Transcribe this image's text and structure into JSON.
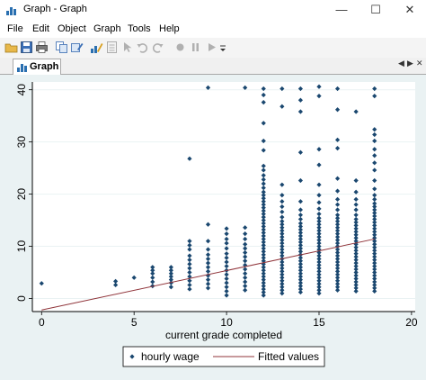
{
  "window": {
    "title": "Graph - Graph",
    "minimize_glyph": "—",
    "maximize_glyph": "☐",
    "close_glyph": "✕"
  },
  "menu": {
    "items": [
      "File",
      "Edit",
      "Object",
      "Graph",
      "Tools",
      "Help"
    ]
  },
  "toolbar": {
    "icons": [
      "open-folder-icon",
      "save-icon",
      "print-icon",
      "copy-icon",
      "rename-icon",
      "graph-editor-icon",
      "properties-icon",
      "pointer-icon",
      "undo-icon",
      "redo-icon",
      "record-icon",
      "pause-icon",
      "play-icon",
      "dropdown-icon"
    ]
  },
  "tab": {
    "label": "Graph",
    "nav_left": "◀",
    "nav_right": "▶",
    "close": "✕"
  },
  "colors": {
    "marker": "#1a476f",
    "fitted_line": "#90353b",
    "plot_background": "#ffffff",
    "graph_background": "#eaf2f3",
    "grid": "#eaf2f3"
  },
  "chart_data": {
    "type": "scatter",
    "xlabel": "current grade completed",
    "ylabel": "",
    "xlim": [
      -0.5,
      20.2
    ],
    "ylim": [
      -2.5,
      41.5
    ],
    "xticks": [
      0,
      5,
      10,
      15,
      20
    ],
    "yticks": [
      0,
      10,
      20,
      30,
      40
    ],
    "grid": true,
    "legend_position": "bottom",
    "series": [
      {
        "name": "hourly wage",
        "kind": "scatter",
        "columns": [
          {
            "x": 0,
            "ys": [
              2.9
            ]
          },
          {
            "x": 4,
            "ys": [
              2.6,
              3.3
            ]
          },
          {
            "x": 5,
            "ys": [
              4.0
            ]
          },
          {
            "x": 6,
            "ys": [
              2.4,
              3.2,
              4.0,
              4.8,
              5.4,
              6.0
            ]
          },
          {
            "x": 7,
            "ys": [
              2.2,
              3.0,
              3.6,
              4.2,
              4.8,
              5.4,
              6.0
            ]
          },
          {
            "x": 8,
            "ys": [
              1.8,
              2.6,
              3.4,
              4.2,
              5.0,
              5.8,
              6.6,
              7.4,
              8.2,
              9.4,
              10.2,
              11.0,
              26.8
            ]
          },
          {
            "x": 9,
            "ys": [
              2.0,
              2.8,
              3.6,
              4.4,
              5.2,
              6.0,
              6.8,
              7.6,
              8.4,
              9.4,
              11.0,
              14.2,
              40.4
            ]
          },
          {
            "x": 10,
            "ys": [
              0.6,
              1.4,
              2.2,
              3.0,
              3.8,
              4.6,
              5.4,
              6.2,
              7.0,
              7.8,
              8.6,
              9.6,
              10.6,
              11.4,
              12.4,
              13.4
            ]
          },
          {
            "x": 11,
            "ys": [
              1.6,
              2.4,
              3.2,
              4.0,
              4.8,
              5.6,
              6.4,
              7.2,
              8.0,
              8.8,
              9.6,
              10.4,
              11.4,
              12.4,
              13.6,
              40.4
            ]
          },
          {
            "x": 12,
            "ys": [
              0.6,
              1.2,
              1.8,
              2.4,
              3.0,
              3.6,
              4.2,
              4.8,
              5.4,
              6.0,
              6.6,
              7.2,
              7.8,
              8.4,
              9.0,
              9.6,
              10.2,
              10.8,
              11.4,
              12.0,
              12.6,
              13.2,
              13.8,
              14.4,
              15.0,
              15.6,
              16.2,
              16.8,
              17.4,
              18.0,
              18.6,
              19.2,
              19.8,
              20.4,
              21.2,
              22.0,
              22.8,
              23.6,
              24.6,
              25.4,
              28.4,
              30.2,
              33.6,
              37.6,
              39.0,
              40.2
            ]
          },
          {
            "x": 13,
            "ys": [
              1.0,
              1.6,
              2.2,
              2.8,
              3.4,
              4.0,
              4.6,
              5.2,
              5.8,
              6.4,
              7.0,
              7.6,
              8.2,
              8.8,
              9.4,
              10.0,
              10.6,
              11.2,
              11.8,
              12.4,
              13.0,
              13.6,
              14.2,
              14.8,
              15.6,
              16.6,
              17.6,
              18.6,
              19.8,
              21.8,
              36.8,
              40.2
            ]
          },
          {
            "x": 14,
            "ys": [
              1.2,
              1.8,
              2.4,
              3.0,
              3.6,
              4.2,
              4.8,
              5.4,
              6.0,
              6.6,
              7.2,
              7.8,
              8.4,
              9.0,
              9.6,
              10.2,
              10.8,
              11.4,
              12.0,
              12.6,
              13.2,
              13.8,
              14.4,
              15.2,
              16.0,
              17.0,
              18.6,
              22.6,
              28.0,
              35.8,
              38.0,
              40.2
            ]
          },
          {
            "x": 15,
            "ys": [
              1.0,
              1.6,
              2.2,
              2.8,
              3.4,
              4.0,
              4.6,
              5.2,
              5.8,
              6.4,
              7.0,
              7.6,
              8.2,
              8.8,
              9.4,
              10.0,
              10.6,
              11.2,
              11.8,
              12.4,
              13.0,
              13.6,
              14.2,
              14.8,
              15.4,
              16.2,
              17.2,
              18.4,
              19.8,
              21.8,
              25.6,
              28.6,
              38.8,
              40.6
            ]
          },
          {
            "x": 16,
            "ys": [
              1.6,
              2.2,
              2.8,
              3.4,
              4.0,
              4.6,
              5.2,
              5.8,
              6.4,
              7.0,
              7.6,
              8.2,
              8.8,
              9.4,
              10.0,
              10.6,
              11.2,
              11.8,
              12.4,
              13.0,
              13.6,
              14.2,
              14.8,
              15.4,
              16.0,
              17.0,
              18.0,
              19.0,
              20.6,
              23.0,
              28.8,
              30.4,
              36.2,
              40.2
            ]
          },
          {
            "x": 17,
            "ys": [
              1.4,
              2.0,
              2.6,
              3.2,
              3.8,
              4.4,
              5.0,
              5.6,
              6.2,
              6.8,
              7.4,
              8.0,
              8.6,
              9.2,
              9.8,
              10.4,
              11.0,
              11.6,
              12.2,
              12.8,
              13.4,
              14.0,
              14.6,
              15.2,
              16.0,
              17.0,
              18.0,
              19.0,
              20.4,
              22.6,
              35.8
            ]
          },
          {
            "x": 18,
            "ys": [
              1.4,
              2.0,
              2.6,
              3.2,
              3.8,
              4.4,
              5.0,
              5.6,
              6.2,
              6.8,
              7.4,
              8.0,
              8.6,
              9.2,
              9.8,
              10.4,
              11.0,
              11.6,
              12.2,
              12.8,
              13.4,
              14.0,
              14.6,
              15.2,
              15.8,
              16.4,
              17.0,
              17.6,
              18.2,
              19.0,
              19.8,
              21.0,
              22.6,
              24.6,
              26.0,
              27.4,
              28.6,
              30.2,
              31.4,
              32.4,
              38.8,
              40.2
            ]
          }
        ]
      },
      {
        "name": "Fitted values",
        "kind": "line",
        "x": [
          0,
          18
        ],
        "y": [
          -2.2,
          11.4
        ]
      }
    ]
  }
}
